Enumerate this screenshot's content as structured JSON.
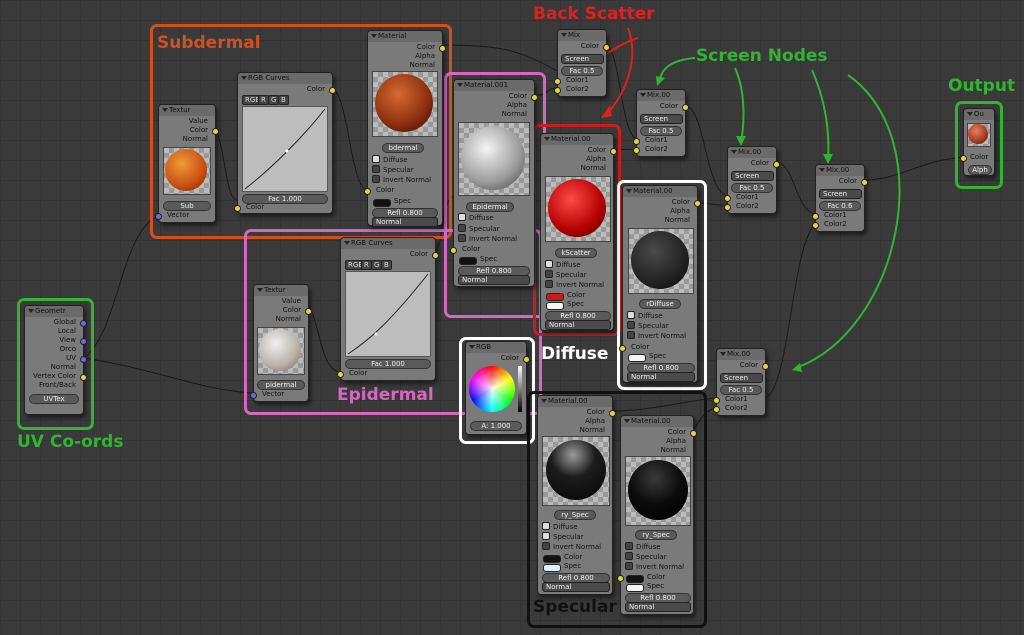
{
  "annotations": {
    "subdermal": "Subdermal",
    "epidermal": "Epidermal",
    "back_scatter": "Back Scatter",
    "screen_nodes": "Screen Nodes",
    "output": "Output",
    "diffuse": "Diffuse",
    "specular": "Specular",
    "uv_coords": "UV Co-ords"
  },
  "colors": {
    "subdermal_box": "#d2501e",
    "epidermal_box": "#d468c0",
    "back_scatter_box": "#c81e1e",
    "diffuse_box": "#ffffff",
    "specular_box": "#111111",
    "green": "#32b432",
    "red_text": "#e02020"
  },
  "geometry_node": {
    "title": "Geometr",
    "outputs": [
      "Global",
      "Local",
      "View",
      "Orco",
      "UV",
      "Normal",
      "Vertex Color",
      "Front/Back"
    ],
    "uv_field": "UVTex"
  },
  "texture_sub": {
    "title": "Textur",
    "outputs": [
      "Value",
      "Color",
      "Normal"
    ],
    "name": "Sub",
    "input": "Vector"
  },
  "texture_epi": {
    "title": "Textur",
    "outputs": [
      "Value",
      "Color",
      "Normal"
    ],
    "name": "pidermal",
    "input": "Vector"
  },
  "curves_sub": {
    "title": "RGB Curves",
    "output": "Color",
    "fac": "Fac 1.000",
    "input": "Color"
  },
  "curves_epi": {
    "title": "RGB Curves",
    "output": "Color",
    "fac": "Fac 1.000",
    "input": "Color"
  },
  "mat_sub": {
    "title": "Material",
    "outputs": [
      "Color",
      "Alpha",
      "Normal"
    ],
    "name": "bdermal",
    "checks": [
      "Diffuse",
      "Specular",
      "Invert Normal"
    ],
    "inputs": [
      "Color",
      "Spec"
    ],
    "refl": "Refl 0.800",
    "normal": "Normal"
  },
  "mat_epi": {
    "title": "Material.001",
    "outputs": [
      "Color",
      "Alpha",
      "Normal"
    ],
    "name": "Epidermal",
    "checks": [
      "Diffuse",
      "Specular",
      "Invert Normal"
    ],
    "inputs": [
      "Color",
      "Spec"
    ],
    "refl": "Refl 0.800",
    "normal": "Normal"
  },
  "mat_back": {
    "title": "Material.00",
    "outputs": [
      "Color",
      "Alpha",
      "Normal"
    ],
    "name": "kScatter",
    "checks": [
      "Diffuse",
      "Specular",
      "Invert Normal"
    ],
    "inputs": [
      "Color",
      "Spec"
    ],
    "refl": "Refl 0.800",
    "normal": "Normal"
  },
  "mat_diff": {
    "title": "Material.00",
    "outputs": [
      "Color",
      "Alpha",
      "Normal"
    ],
    "name": "rDiffuse",
    "checks": [
      "Diffuse",
      "Specular",
      "Invert Normal"
    ],
    "inputs": [
      "Color",
      "Spec"
    ],
    "refl": "Refl 0.800",
    "normal": "Normal"
  },
  "mat_spec1": {
    "title": "Material.00",
    "outputs": [
      "Color",
      "Alpha",
      "Normal"
    ],
    "name": "ry_Spec",
    "checks": [
      "Diffuse",
      "Specular",
      "Invert Normal"
    ],
    "inputs": [
      "Color",
      "Spec"
    ],
    "refl": "Refl 0.800",
    "normal": "Normal"
  },
  "mat_spec2": {
    "title": "Material.00",
    "outputs": [
      "Color",
      "Alpha",
      "Normal"
    ],
    "name": "ry_Spec",
    "checks": [
      "Diffuse",
      "Specular",
      "Invert Normal"
    ],
    "inputs": [
      "Color",
      "Spec"
    ],
    "refl": "Refl 0.800",
    "normal": "Normal"
  },
  "mix1": {
    "title": "Mix",
    "output": "Color",
    "mode": "Screen",
    "fac": "Fac 0.5",
    "inputs": [
      "Color1",
      "Color2"
    ]
  },
  "mix2": {
    "title": "Mix.00",
    "output": "Color",
    "mode": "Screen",
    "fac": "Fac 0.5",
    "inputs": [
      "Color1",
      "Color2"
    ]
  },
  "mix3": {
    "title": "Mix.00",
    "output": "Color",
    "mode": "Screen",
    "fac": "Fac 0.5",
    "inputs": [
      "Color1",
      "Color2"
    ]
  },
  "mix4": {
    "title": "Mix.00",
    "output": "Color",
    "mode": "Screen",
    "fac": "Fac 0.6",
    "inputs": [
      "Color1",
      "Color2"
    ]
  },
  "mix5": {
    "title": "Mix.00",
    "output": "Color",
    "mode": "Screen",
    "fac": "Fac 0.5",
    "inputs": [
      "Color1",
      "Color2"
    ]
  },
  "rgb_node": {
    "title": "RGB",
    "output": "Color",
    "alpha": "A: 1.000"
  },
  "output_node": {
    "title": "Ou",
    "inputs": [
      "Color",
      "Alph"
    ]
  },
  "curve_buttons": [
    "RGB",
    "R",
    "G",
    "B"
  ]
}
